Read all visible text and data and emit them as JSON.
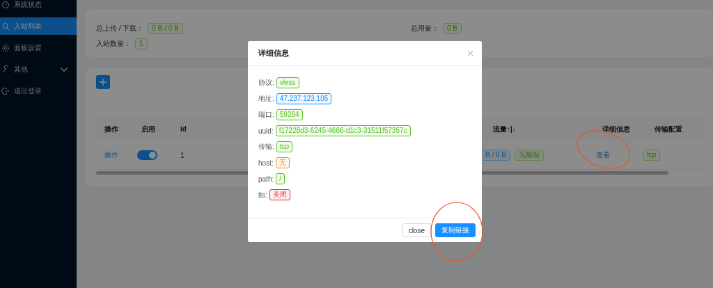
{
  "sidebar": {
    "items": [
      {
        "label": "系统状态",
        "selected": false
      },
      {
        "label": "入站列表",
        "selected": true
      },
      {
        "label": "面板设置",
        "selected": false
      },
      {
        "label": "其他",
        "selected": false,
        "expanded": false
      },
      {
        "label": "退出登录",
        "selected": false
      }
    ]
  },
  "summary": {
    "stats": [
      {
        "label": "总上传 / 下载：",
        "value": "0 B / 0 B"
      },
      {
        "label": "总用量：",
        "value": "0 B"
      },
      {
        "label": "入站数量：",
        "value": "1"
      }
    ]
  },
  "table": {
    "columns": [
      "操作",
      "启用",
      "id",
      "流量↑|↓",
      "详细信息",
      "传输配置"
    ],
    "rows": [
      {
        "action": "操作",
        "enabled": true,
        "id": "1",
        "traffic": "B / 0 B",
        "limit": "无限制",
        "details": "查看",
        "transport": "tcp"
      }
    ]
  },
  "modal": {
    "title": "详细信息",
    "fields": [
      {
        "label": "协议:",
        "value": "vless",
        "color": "#52c41a"
      },
      {
        "label": "地址:",
        "value": "47.237.123.105",
        "color": "#1890ff"
      },
      {
        "label": "端口:",
        "value": "59284",
        "color": "#52c41a"
      },
      {
        "label": "uuid:",
        "value": "f17228d3-6245-4666-d1c3-31511f57357c",
        "color": "#52c41a"
      },
      {
        "label": "传输:",
        "value": "tcp",
        "color": "#52c41a"
      },
      {
        "label": "host:",
        "value": "无",
        "color": "#fa8c16"
      },
      {
        "label": "path:",
        "value": "/",
        "color": "#52c41a"
      },
      {
        "label": "tls:",
        "value": "关闭",
        "color": "#f5222d"
      }
    ],
    "buttons": [
      {
        "label": "close",
        "kind": "default"
      },
      {
        "label": "复制链接",
        "kind": "primary"
      }
    ]
  }
}
